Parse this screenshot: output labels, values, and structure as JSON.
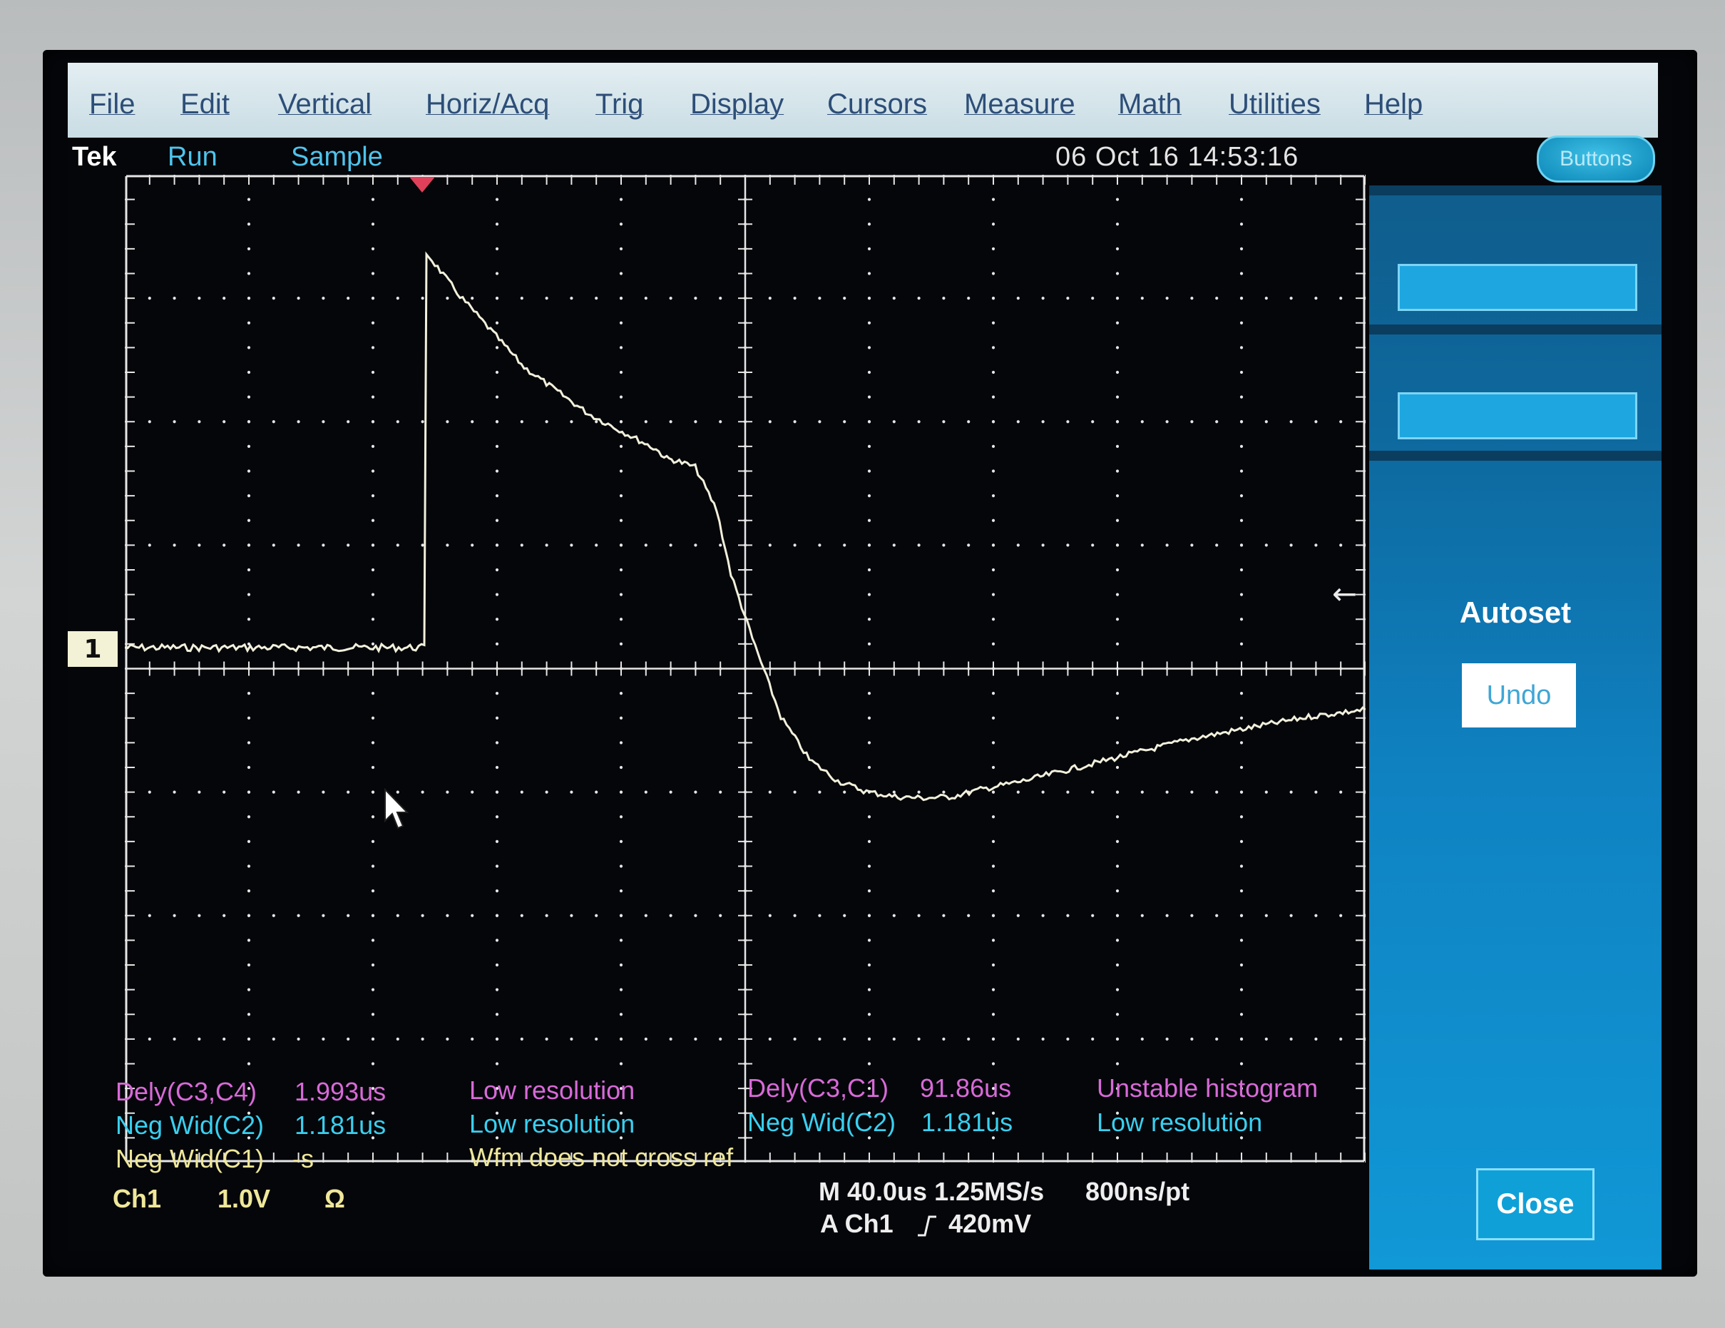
{
  "menu": {
    "items": [
      "File",
      "Edit",
      "Vertical",
      "Horiz/Acq",
      "Trig",
      "Display",
      "Cursors",
      "Measure",
      "Math",
      "Utilities",
      "Help"
    ]
  },
  "status": {
    "brand": "Tek",
    "run_state": "Run",
    "acq_mode": "Sample",
    "datetime": "06 Oct 16 14:53:16",
    "buttons_label": "Buttons"
  },
  "right_panel": {
    "autoset_label": "Autoset",
    "undo_label": "Undo",
    "close_label": "Close"
  },
  "ref_marker": "1",
  "measurements": {
    "left": [
      {
        "name": "Dely(C3,C4)",
        "value": "1.993us",
        "note": "Low resolution"
      },
      {
        "name": "Neg Wid(C2)",
        "value": "1.181us",
        "note": "Low resolution"
      },
      {
        "name": "Neg Wid(C1)",
        "value": "-s",
        "note": "Wfm does not cross ref"
      }
    ],
    "right": [
      {
        "name": "Dely(C3,C1)",
        "value": "91.86us",
        "note": "Unstable histogram"
      },
      {
        "name": "Neg Wid(C2)",
        "value": "1.181us",
        "note": "Low resolution"
      }
    ]
  },
  "channel": {
    "name": "Ch1",
    "scale": "1.0V",
    "coupling": "Ω"
  },
  "horizontal": {
    "line1": "M 40.0us 1.25MS/s",
    "resolution": "800ns/pt",
    "trigger_src": "A Ch1",
    "slope_icon": "rising-edge-icon",
    "trigger_level": "420mV"
  },
  "colors": {
    "trace": "#f2f0dc",
    "graticule": "#e6e6e6",
    "panel": "#0f82c2"
  }
}
